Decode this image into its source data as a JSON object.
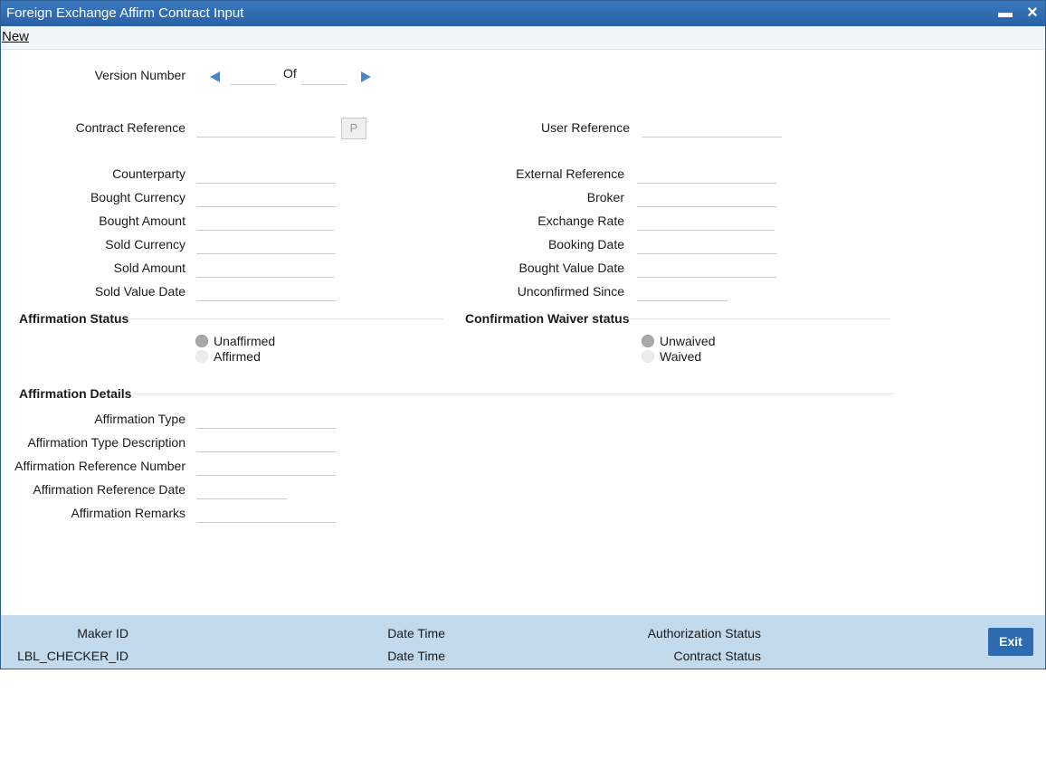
{
  "window": {
    "title": "Foreign Exchange Affirm Contract Input",
    "minimize_glyph": "▬",
    "close_glyph": "✕"
  },
  "menu": {
    "new_label": "New"
  },
  "version": {
    "label": "Version Number",
    "of_label": "Of",
    "current": "",
    "total": ""
  },
  "contract": {
    "reference_label": "Contract Reference",
    "reference_value": "",
    "p_button": "P",
    "user_reference_label": "User Reference",
    "user_reference_value": ""
  },
  "left_fields": [
    {
      "label": "Counterparty",
      "value": ""
    },
    {
      "label": "Bought Currency",
      "value": ""
    },
    {
      "label": "Bought Amount",
      "value": ""
    },
    {
      "label": "Sold Currency",
      "value": ""
    },
    {
      "label": "Sold Amount",
      "value": ""
    },
    {
      "label": "Sold Value Date",
      "value": ""
    }
  ],
  "right_fields": [
    {
      "label": "External Reference",
      "value": ""
    },
    {
      "label": "Broker",
      "value": ""
    },
    {
      "label": "Exchange Rate",
      "value": ""
    },
    {
      "label": "Booking Date",
      "value": ""
    },
    {
      "label": "Bought Value Date",
      "value": ""
    },
    {
      "label": "Unconfirmed Since",
      "value": ""
    }
  ],
  "affirmation_status": {
    "title": "Affirmation Status",
    "options": [
      "Unaffirmed",
      "Affirmed"
    ],
    "selected": "Unaffirmed"
  },
  "waiver_status": {
    "title": "Confirmation Waiver status",
    "options": [
      "Unwaived",
      "Waived"
    ],
    "selected": "Unwaived"
  },
  "affirmation_details": {
    "title": "Affirmation Details",
    "fields": [
      {
        "label": "Affirmation Type",
        "value": ""
      },
      {
        "label": "Affirmation Type Description",
        "value": ""
      },
      {
        "label": "Affirmation Reference Number",
        "value": ""
      },
      {
        "label": "Affirmation Reference Date",
        "value": ""
      },
      {
        "label": "Affirmation Remarks",
        "value": ""
      }
    ]
  },
  "footer": {
    "maker_id_label": "Maker ID",
    "checker_id_label": "LBL_CHECKER_ID",
    "date_time_label_1": "Date Time",
    "date_time_label_2": "Date Time",
    "authorization_status_label": "Authorization Status",
    "contract_status_label": "Contract Status",
    "exit_label": "Exit"
  },
  "colors": {
    "titlebar": "#2f6bb0",
    "footer": "#c3d9ec",
    "accent_arrow": "#4d86c4",
    "exit_button": "#2f6bb0"
  }
}
